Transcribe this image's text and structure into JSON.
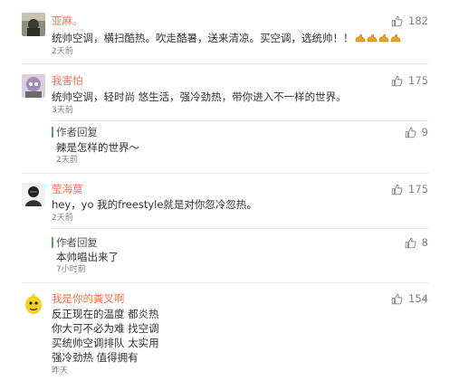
{
  "comments": [
    {
      "username": "亚麻。",
      "text": "统帅空调，横扫酷热。吹走酷暑，送来清凉。买空调，选统帅！！",
      "emoji_count": 4,
      "time": "2天前",
      "likes": "182"
    },
    {
      "username": "我害怕",
      "text": "统帅空调，轻时尚 悠生活，强冷劲热，带你进入不一样的世界。",
      "time": "3天前",
      "likes": "175",
      "reply": {
        "label": "作者回复",
        "text": "辣是怎样的世界～",
        "time": "2天前",
        "likes": "9"
      }
    },
    {
      "username": "莹海莫",
      "text": "hey，yo 我的freestyle就是对你忽冷忽热。",
      "time": "2天前",
      "likes": "175",
      "reply": {
        "label": "作者回复",
        "text": "本帅唱出来了",
        "time": "7小时前",
        "likes": "8"
      }
    },
    {
      "username": "我是你的粪叉啊",
      "lines": [
        "反正现在的温度 都炎热",
        "你大可不必为难 找空调",
        "买统帅空调排队 太实用",
        "强冷劲热 值得拥有"
      ],
      "time": "昨天",
      "likes": "154"
    }
  ],
  "colors": {
    "username": "#eb7350",
    "reply_bar": "#4caf50",
    "muted": "#808080"
  },
  "icons": {
    "like": "thumbs-up-icon",
    "emoji": "flexing-arm-emoji"
  }
}
